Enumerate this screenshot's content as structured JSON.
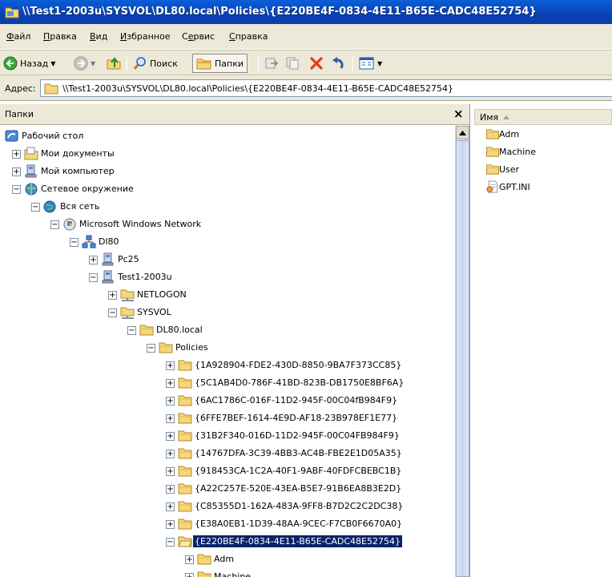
{
  "window": {
    "title": "\\\\Test1-2003u\\SYSVOL\\DL80.local\\Policies\\{E220BE4F-0834-4E11-B65E-CADC48E52754}"
  },
  "menu": {
    "items": [
      "Файл",
      "Правка",
      "Вид",
      "Избранное",
      "Сервис",
      "Справка"
    ],
    "underline": [
      "Ф",
      "П",
      "В",
      "И",
      "е",
      "С"
    ]
  },
  "toolbar": {
    "back_label": "Назад",
    "search_label": "Поиск",
    "folders_label": "Папки"
  },
  "address": {
    "label": "Адрес:",
    "value": "\\\\Test1-2003u\\SYSVOL\\DL80.local\\Policies\\{E220BE4F-0834-4E11-B65E-CADC48E52754}"
  },
  "folders_pane": {
    "title": "Папки",
    "close": "×"
  },
  "tree": [
    {
      "label": "Рабочий стол",
      "level": 0,
      "expander": "",
      "icon": "desktop-icon"
    },
    {
      "label": "Мои документы",
      "level": 1,
      "expander": "+",
      "icon": "my-documents-icon"
    },
    {
      "label": "Мой компьютер",
      "level": 1,
      "expander": "+",
      "icon": "my-computer-icon"
    },
    {
      "label": "Сетевое окружение",
      "level": 1,
      "expander": "−",
      "icon": "network-places-icon"
    },
    {
      "label": "Вся сеть",
      "level": 2,
      "expander": "−",
      "icon": "entire-network-icon"
    },
    {
      "label": "Microsoft Windows Network",
      "level": 3,
      "expander": "−",
      "icon": "windows-network-icon"
    },
    {
      "label": "Dl80",
      "level": 4,
      "expander": "−",
      "icon": "domain-icon"
    },
    {
      "label": "Pc25",
      "level": 5,
      "expander": "+",
      "icon": "computer-icon"
    },
    {
      "label": "Test1-2003u",
      "level": 5,
      "expander": "−",
      "icon": "computer-icon"
    },
    {
      "label": "NETLOGON",
      "level": 6,
      "expander": "+",
      "icon": "share-icon"
    },
    {
      "label": "SYSVOL",
      "level": 6,
      "expander": "−",
      "icon": "share-icon"
    },
    {
      "label": "DL80.local",
      "level": 7,
      "expander": "−",
      "icon": "folder-icon"
    },
    {
      "label": "Policies",
      "level": 8,
      "expander": "−",
      "icon": "folder-icon"
    },
    {
      "label": "{1A928904-FDE2-430D-8850-9BA7F373CC85}",
      "level": 9,
      "expander": "+",
      "icon": "folder-icon"
    },
    {
      "label": "{5C1AB4D0-786F-41BD-823B-DB1750E8BF6A}",
      "level": 9,
      "expander": "+",
      "icon": "folder-icon"
    },
    {
      "label": "{6AC1786C-016F-11D2-945F-00C04fB984F9}",
      "level": 9,
      "expander": "+",
      "icon": "folder-icon"
    },
    {
      "label": "{6FFE7BEF-1614-4E9D-AF18-23B978EF1E77}",
      "level": 9,
      "expander": "+",
      "icon": "folder-icon"
    },
    {
      "label": "{31B2F340-016D-11D2-945F-00C04FB984F9}",
      "level": 9,
      "expander": "+",
      "icon": "folder-icon"
    },
    {
      "label": "{14767DFA-3C39-4BB3-AC4B-FBE2E1D05A35}",
      "level": 9,
      "expander": "+",
      "icon": "folder-icon"
    },
    {
      "label": "{918453CA-1C2A-40F1-9ABF-40FDFCBEBC1B}",
      "level": 9,
      "expander": "+",
      "icon": "folder-icon"
    },
    {
      "label": "{A22C257E-520E-43EA-B5E7-91B6EA8B3E2D}",
      "level": 9,
      "expander": "+",
      "icon": "folder-icon"
    },
    {
      "label": "{C85355D1-162A-483A-9FF8-B7D2C2C2DC38}",
      "level": 9,
      "expander": "+",
      "icon": "folder-icon"
    },
    {
      "label": "{E38A0EB1-1D39-48AA-9CEC-F7CB0F6670A0}",
      "level": 9,
      "expander": "+",
      "icon": "folder-icon"
    },
    {
      "label": "{E220BE4F-0834-4E11-B65E-CADC48E52754}",
      "level": 9,
      "expander": "−",
      "icon": "folder-open-icon",
      "selected": true
    },
    {
      "label": "Adm",
      "level": 10,
      "expander": "+",
      "icon": "folder-icon"
    },
    {
      "label": "Machine",
      "level": 10,
      "expander": "+",
      "icon": "folder-icon"
    }
  ],
  "list_pane": {
    "column_name": "Имя",
    "items": [
      {
        "label": "Adm",
        "icon": "folder-icon"
      },
      {
        "label": "Machine",
        "icon": "folder-icon"
      },
      {
        "label": "User",
        "icon": "folder-icon"
      },
      {
        "label": "GPT.INI",
        "icon": "ini-file-icon"
      }
    ]
  },
  "colors": {
    "title_bar": "#0a4fc8",
    "selection": "#0a246a",
    "chrome": "#ece9d8",
    "folder": "#f5d77a"
  }
}
